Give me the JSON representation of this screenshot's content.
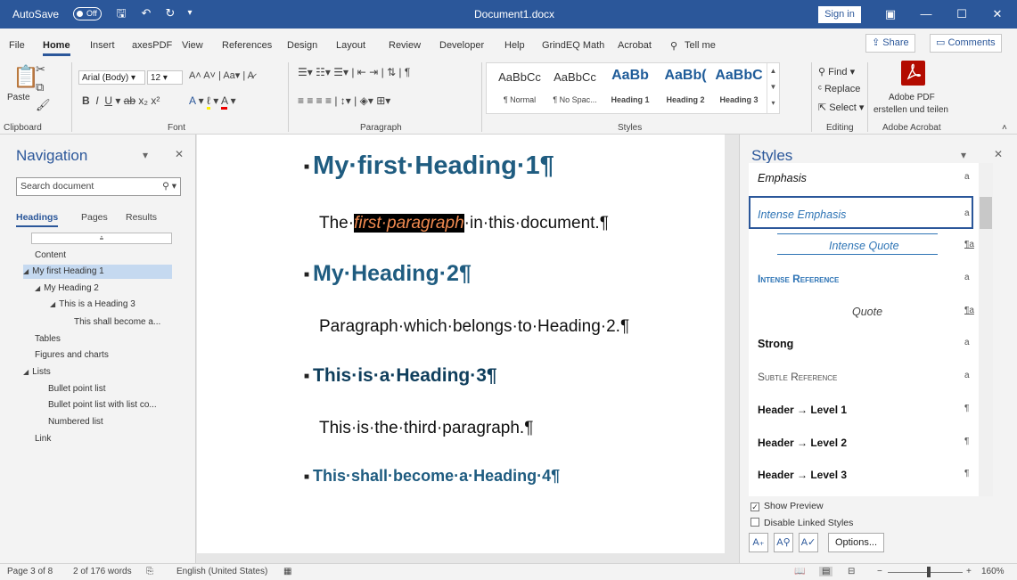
{
  "titlebar": {
    "autosave_label": "AutoSave",
    "autosave_state": "Off",
    "doc_title": "Document1.docx",
    "sign_in": "Sign in"
  },
  "ribbon_tabs": [
    "File",
    "Home",
    "Insert",
    "axesPDF",
    "View",
    "References",
    "Design",
    "Layout",
    "Review",
    "Developer",
    "Help",
    "GrindEQ Math",
    "Acrobat",
    "Tell me"
  ],
  "active_tab": "Home",
  "share": {
    "share_label": "Share",
    "comments_label": "Comments"
  },
  "ribbon": {
    "paste_label": "Paste",
    "font_name": "Arial (Body)",
    "font_size": "12",
    "groups": {
      "clipboard": "Clipboard",
      "font": "Font",
      "paragraph": "Paragraph",
      "styles": "Styles",
      "editing": "Editing",
      "acrobat": "Adobe Acrobat"
    },
    "style_gallery": [
      {
        "preview": "AaBbCc",
        "name": "¶ Normal"
      },
      {
        "preview": "AaBbCc",
        "name": "¶ No Spac..."
      },
      {
        "preview": "AaBb",
        "name": "Heading 1"
      },
      {
        "preview": "AaBb(",
        "name": "Heading 2"
      },
      {
        "preview": "AaBbC",
        "name": "Heading 3"
      }
    ],
    "editing": {
      "find": "Find",
      "replace": "Replace",
      "select": "Select"
    },
    "acrobat_line1": "Adobe PDF",
    "acrobat_line2": "erstellen und teilen"
  },
  "navigation": {
    "title": "Navigation",
    "search_placeholder": "Search document",
    "tabs": [
      "Headings",
      "Pages",
      "Results"
    ],
    "tree": [
      "Content",
      "My first Heading 1",
      "My Heading 2",
      "This is a Heading 3",
      "This shall become a...",
      "Tables",
      "Figures and charts",
      "Lists",
      "Bullet point list",
      "Bullet point list with list co...",
      "Numbered list",
      "Link"
    ]
  },
  "document": {
    "h1": "My·first·Heading·1¶",
    "p1_before": "The·",
    "p1_highlight": "first·paragraph",
    "p1_after": "·in·this·document.¶",
    "h2": "My·Heading·2¶",
    "p2": "Paragraph·which·belongs·to·Heading·2.¶",
    "h3": "This·is·a·Heading·3¶",
    "p3": "This·is·the·third·paragraph.¶",
    "h4": "This·shall·become·a·Heading·4¶"
  },
  "styles_pane": {
    "title": "Styles",
    "items": [
      {
        "name": "Emphasis",
        "type": "a"
      },
      {
        "name": "Intense Emphasis",
        "type": "a"
      },
      {
        "name": "Intense Quote",
        "type": "¶a"
      },
      {
        "name": "Intense Reference",
        "type": "a"
      },
      {
        "name": "Quote",
        "type": "¶a"
      },
      {
        "name": "Strong",
        "type": "a"
      },
      {
        "name": "Subtle Reference",
        "type": "a"
      },
      {
        "name": "Header → Level 1",
        "type": "¶"
      },
      {
        "name": "Header → Level 2",
        "type": "¶"
      },
      {
        "name": "Header → Level 3",
        "type": "¶"
      }
    ],
    "show_preview": "Show Preview",
    "disable_linked": "Disable Linked Styles",
    "options": "Options..."
  },
  "statusbar": {
    "page": "Page 3 of 8",
    "words": "2 of 176 words",
    "language": "English (United States)",
    "zoom": "160%"
  },
  "colors": {
    "accent": "#2b579a",
    "heading": "#1f4e79",
    "highlight_text": "#f08a50"
  }
}
